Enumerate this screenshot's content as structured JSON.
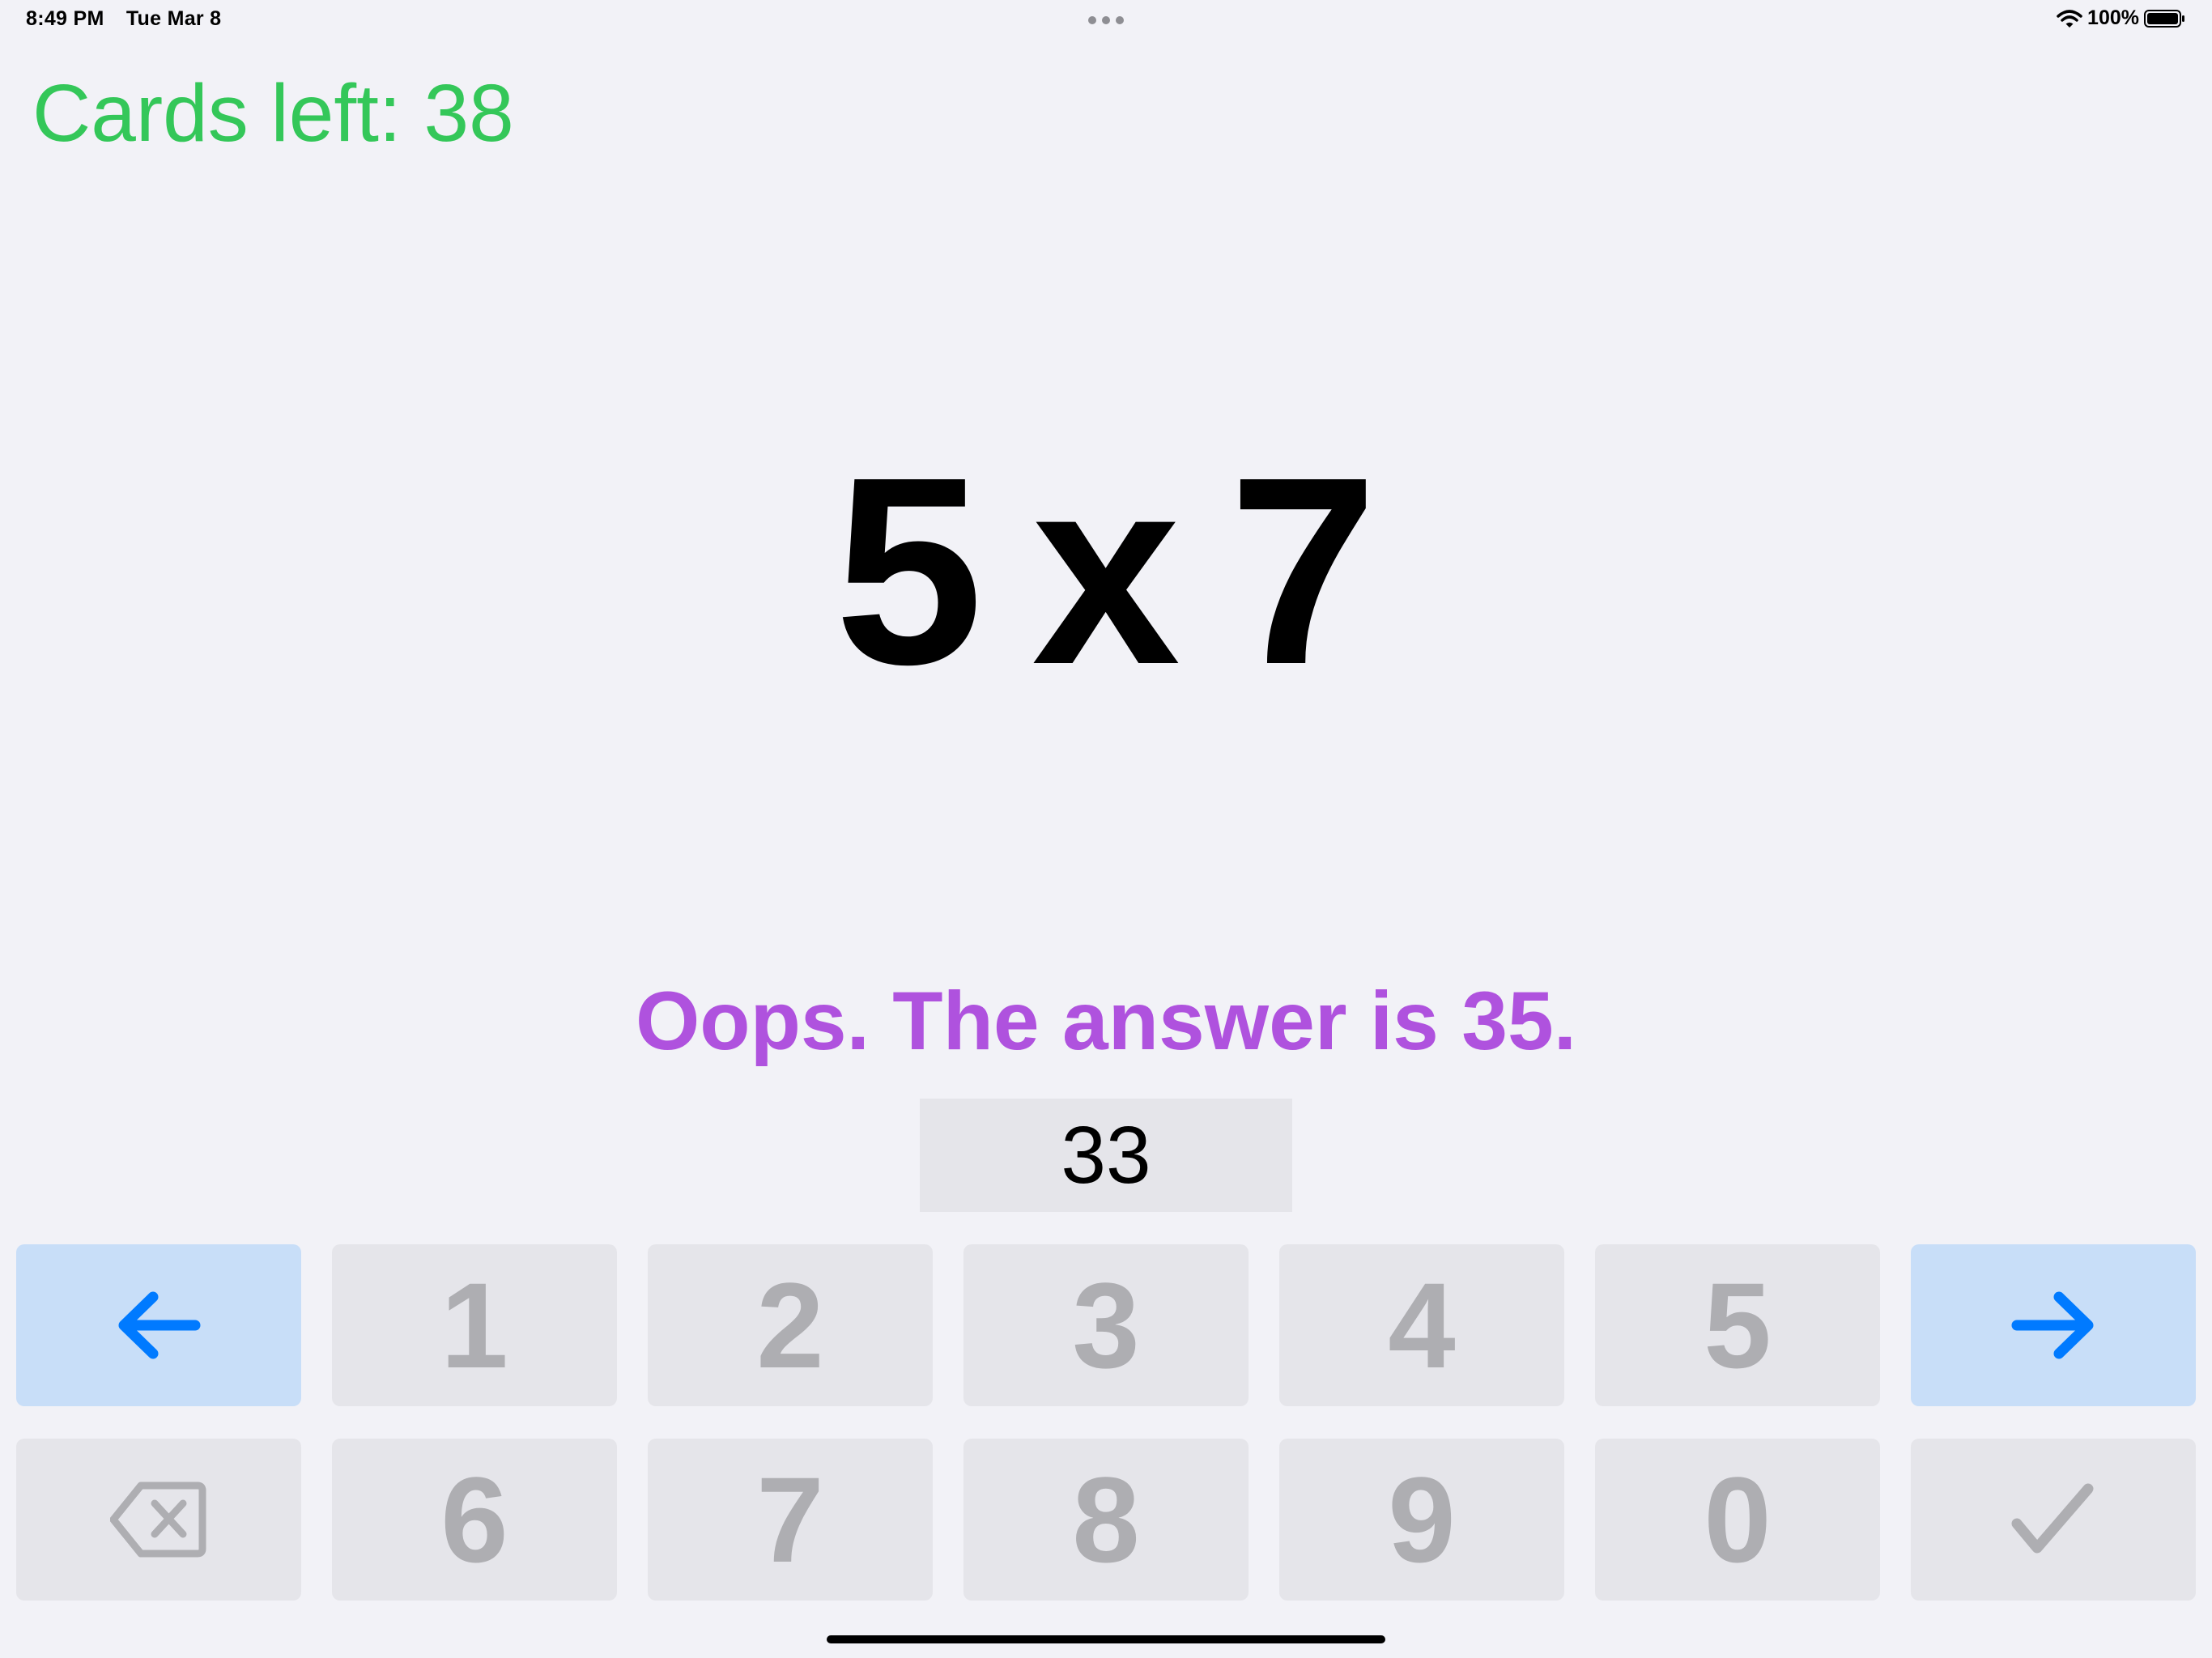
{
  "status_bar": {
    "time": "8:49 PM",
    "date": "Tue Mar 8",
    "battery": "100%",
    "icons": [
      "wifi-icon",
      "battery-icon",
      "multitasking-dots-icon"
    ]
  },
  "header": {
    "cards_left": "Cards left: 38"
  },
  "problem": {
    "left": "5",
    "operator": "x",
    "right": "7"
  },
  "feedback": {
    "message": "Oops. The answer is 35."
  },
  "answer": {
    "value": "33"
  },
  "keypad": {
    "row1": [
      "1",
      "2",
      "3",
      "4",
      "5"
    ],
    "row2": [
      "6",
      "7",
      "8",
      "9",
      "0"
    ],
    "icons": {
      "back": "arrow-left-icon",
      "next": "arrow-right-icon",
      "delete": "backspace-icon",
      "submit": "checkmark-icon"
    }
  },
  "colors": {
    "background": "#F2F2F7",
    "cards_left": "#34C759",
    "feedback": "#AF52DE",
    "accent": "#007AFF",
    "key_bg": "#E5E5EA",
    "key_nav_bg": "#C8DEF8",
    "key_text": "#AEAEB2"
  }
}
